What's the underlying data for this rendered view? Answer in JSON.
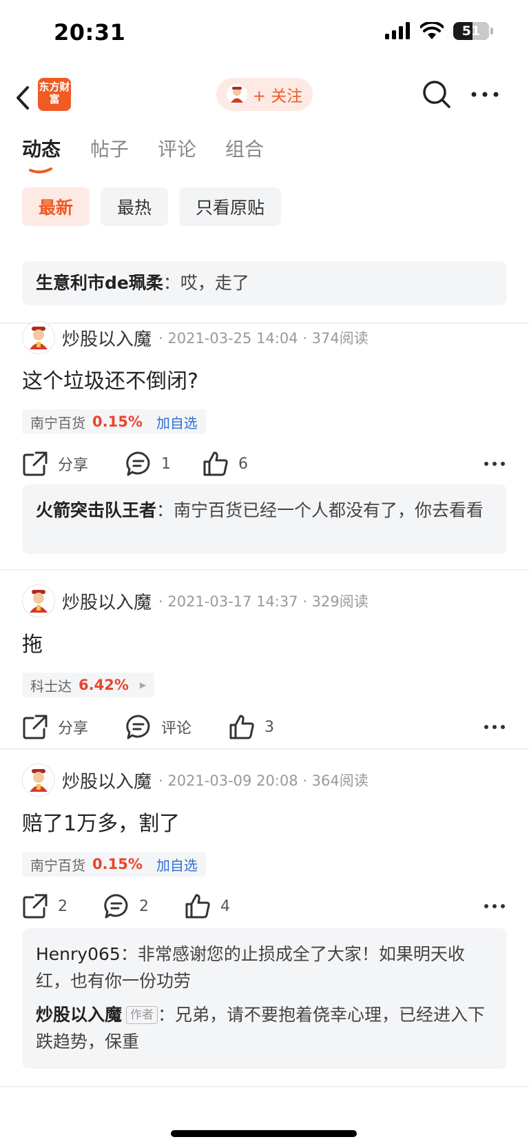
{
  "status_bar": {
    "time": "20:31",
    "battery": "51"
  },
  "nav": {
    "logo_text": "东方财富",
    "follow_label": "+ 关注"
  },
  "tabs": [
    {
      "label": "动态",
      "active": true
    },
    {
      "label": "帖子",
      "active": false
    },
    {
      "label": "评论",
      "active": false
    },
    {
      "label": "组合",
      "active": false
    }
  ],
  "filters": [
    {
      "label": "最新",
      "active": true
    },
    {
      "label": "最热",
      "active": false
    },
    {
      "label": "只看原贴",
      "active": false
    }
  ],
  "top_comment": {
    "author": "生意利市de珮柔",
    "sep": "：",
    "text": "哎，走了"
  },
  "posts": [
    {
      "username": "炒股以入魔",
      "meta": "· 2021-03-25 14:04 · 374阅读",
      "text": "这个垃圾还不倒闭?",
      "stock": {
        "name": "南宁百货",
        "change": "0.15%",
        "add": "加自选"
      },
      "actions": {
        "share": "分享",
        "comment": "1",
        "like": "6"
      },
      "comments": [
        {
          "author": "火箭突击队王者",
          "sep": "：",
          "text": "南宁百货已经一个人都没有了，你去看看"
        }
      ]
    },
    {
      "username": "炒股以入魔",
      "meta": "· 2021-03-17 14:37 · 329阅读",
      "text": "拖",
      "stock": {
        "name": "科士达",
        "change": "6.42%"
      },
      "actions": {
        "share": "分享",
        "comment": "评论",
        "like": "3"
      }
    },
    {
      "username": "炒股以入魔",
      "meta": "· 2021-03-09 20:08 · 364阅读",
      "text": "赔了1万多，割了",
      "stock": {
        "name": "南宁百货",
        "change": "0.15%",
        "add": "加自选"
      },
      "actions": {
        "share": "2",
        "comment": "2",
        "like": "4"
      },
      "comments": [
        {
          "author": "Henry065",
          "sep": "：",
          "text": "非常感谢您的止损成全了大家！如果明天收红，也有你一份功劳"
        },
        {
          "author": "炒股以入魔",
          "tag": "作者",
          "sep": "：",
          "text": "兄弟，请不要抱着侥幸心理，已经进入下跌趋势，保重"
        }
      ]
    }
  ],
  "colors": {
    "accent": "#f05a23",
    "up": "#e8452c",
    "link": "#2f6fd0"
  },
  "icons": [
    "back-icon",
    "search-icon",
    "more-icon",
    "share-icon",
    "comment-icon",
    "like-icon"
  ]
}
